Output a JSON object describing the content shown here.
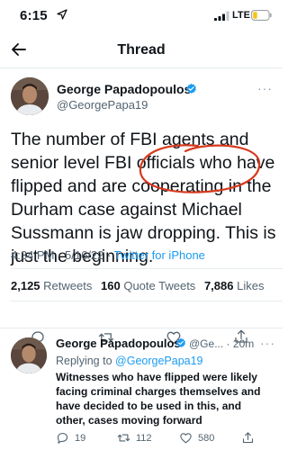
{
  "status_bar": {
    "time": "6:15",
    "network": "LTE"
  },
  "nav": {
    "title": "Thread"
  },
  "main_tweet": {
    "author_name": "George Papadopoulos",
    "author_handle": "@GeorgePapa19",
    "more": "···",
    "text": "The number of FBI agents and senior level FBI officials who have flipped and are cooperating in the Durham case against Michael Sussmann is jaw dropping. This is just the beginning.",
    "time": "4:34 PM",
    "date": "5/16/22",
    "separator": "·",
    "source": "Twitter for iPhone",
    "stats": {
      "retweets_count": "2,125",
      "retweets_label": "Retweets",
      "quotes_count": "160",
      "quotes_label": "Quote Tweets",
      "likes_count": "7,886",
      "likes_label": "Likes"
    }
  },
  "reply_tweet": {
    "author_name": "George Papadopoulos",
    "author_handle_trunc": "@Ge...",
    "separator": "·",
    "age": "20m",
    "more": "···",
    "replying_prefix": "Replying to",
    "replying_to": "@GeorgePapa19",
    "text": "Witnesses who have flipped were likely facing criminal charges themselves and have decided to be used in this, and other, cases moving forward",
    "reply_count": "19",
    "retweet_count": "112",
    "like_count": "580"
  },
  "colors": {
    "link": "#1d9bf0",
    "verified": "#1d9bf0",
    "annotation": "#d63a1e",
    "battery": "#f5c518"
  },
  "icons": [
    "location-arrow-icon",
    "signal-icon",
    "battery-icon",
    "back-arrow-icon",
    "verified-badge-icon",
    "reply-icon",
    "retweet-icon",
    "like-icon",
    "share-icon"
  ]
}
